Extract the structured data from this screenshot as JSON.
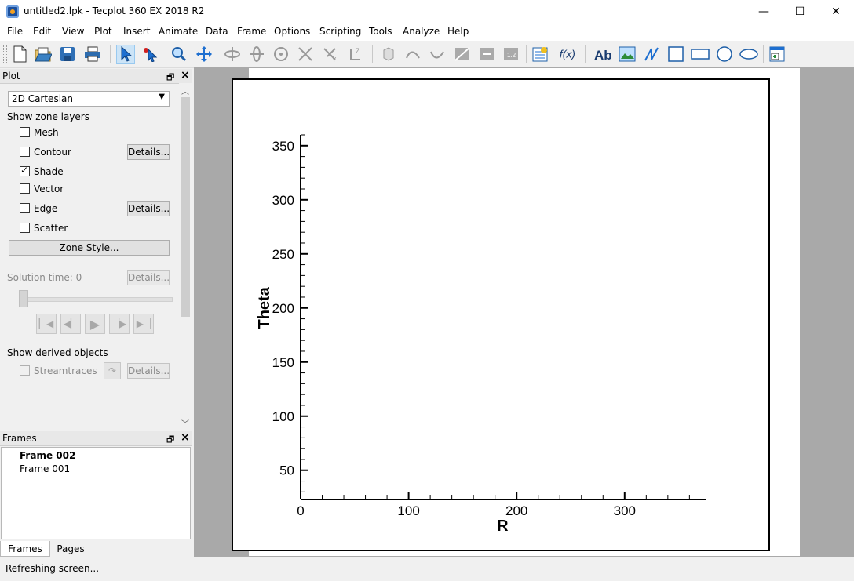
{
  "window": {
    "title": "untitled2.lpk - Tecplot 360 EX 2018 R2",
    "minimize": "—",
    "maximize": "☐",
    "close": "✕"
  },
  "menu": [
    "File",
    "Edit",
    "View",
    "Plot",
    "Insert",
    "Animate",
    "Data",
    "Frame",
    "Options",
    "Scripting",
    "Tools",
    "Analyze",
    "Help"
  ],
  "toolbar": {
    "icons": [
      "new-file-icon",
      "open-file-icon",
      "save-icon",
      "print-icon",
      "select-arrow-icon",
      "adjustor-icon",
      "zoom-icon",
      "translate-icon",
      "rotate-icons",
      "probe-icons",
      "text-icon",
      "frame-icon"
    ]
  },
  "plot_panel": {
    "header": "Plot",
    "plot_type": "2D Cartesian",
    "show_zone_layers": "Show zone layers",
    "layers": [
      {
        "label": "Mesh",
        "checked": false,
        "details": false
      },
      {
        "label": "Contour",
        "checked": false,
        "details": true
      },
      {
        "label": "Shade",
        "checked": true,
        "details": false
      },
      {
        "label": "Vector",
        "checked": false,
        "details": false
      },
      {
        "label": "Edge",
        "checked": false,
        "details": true
      },
      {
        "label": "Scatter",
        "checked": false,
        "details": false
      }
    ],
    "details_label": "Details...",
    "zone_style": "Zone Style...",
    "solution_time": "Solution time:  0",
    "show_derived": "Show derived objects",
    "streamtraces": "Streamtraces"
  },
  "frames_panel": {
    "header": "Frames",
    "frames": [
      "Frame 002",
      "Frame 001"
    ],
    "tabs": [
      "Frames",
      "Pages"
    ]
  },
  "status": {
    "text": "Refreshing screen..."
  },
  "chart_data": {
    "type": "scatter",
    "title": "",
    "xlabel": "R",
    "ylabel": "Theta",
    "xlim": [
      0,
      375
    ],
    "ylim": [
      23,
      360
    ],
    "x_ticks": [
      0,
      100,
      200,
      300
    ],
    "y_ticks": [
      50,
      100,
      150,
      200,
      250,
      300,
      350
    ],
    "series": []
  }
}
